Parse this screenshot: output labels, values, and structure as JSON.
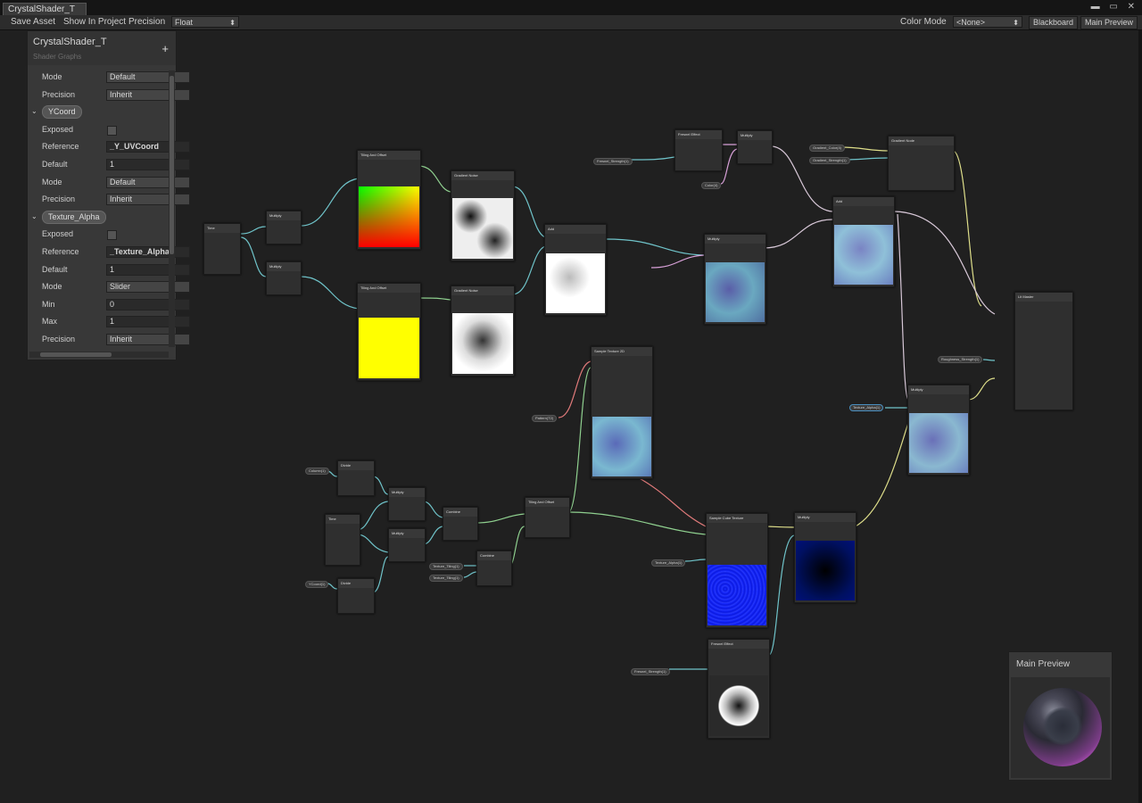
{
  "window": {
    "tab_title": "CrystalShader_T",
    "controls": "▬ ▭ ✕"
  },
  "toolbar": {
    "save_asset": "Save Asset",
    "show_in_project": "Show In Project",
    "precision_label": "Precision",
    "precision_value": "Float",
    "color_mode_label": "Color Mode",
    "color_mode_value": "<None>",
    "blackboard": "Blackboard",
    "main_preview": "Main Preview"
  },
  "blackboard": {
    "title": "CrystalShader_T",
    "subtitle": "Shader Graphs",
    "add_icon": "+",
    "rows": [
      {
        "type": "field",
        "label": "Mode",
        "value": "Default"
      },
      {
        "type": "field",
        "label": "Precision",
        "value": "Inherit"
      },
      {
        "type": "prop",
        "label": "YCoord"
      },
      {
        "type": "check",
        "label": "Exposed"
      },
      {
        "type": "bold",
        "label": "Reference",
        "value": "_Y_UVCoord"
      },
      {
        "type": "num",
        "label": "Default",
        "value": "1"
      },
      {
        "type": "field",
        "label": "Mode",
        "value": "Default"
      },
      {
        "type": "field",
        "label": "Precision",
        "value": "Inherit"
      },
      {
        "type": "prop",
        "label": "Texture_Alpha"
      },
      {
        "type": "check",
        "label": "Exposed"
      },
      {
        "type": "bold",
        "label": "Reference",
        "value": "_Texture_Alpha"
      },
      {
        "type": "num",
        "label": "Default",
        "value": "1"
      },
      {
        "type": "field",
        "label": "Mode",
        "value": "Slider"
      },
      {
        "type": "num",
        "label": "Min",
        "value": "0"
      },
      {
        "type": "num",
        "label": "Max",
        "value": "1"
      },
      {
        "type": "field",
        "label": "Precision",
        "value": "Inherit"
      }
    ]
  },
  "main_preview": {
    "title": "Main Preview"
  },
  "nodes": [
    {
      "title": "Time"
    },
    {
      "title": "Multiply"
    },
    {
      "title": "Multiply"
    },
    {
      "title": "Tiling And Offset"
    },
    {
      "title": "Tiling And Offset"
    },
    {
      "title": "Gradient Noise"
    },
    {
      "title": "Gradient Noise"
    },
    {
      "title": "Add"
    },
    {
      "title": "Fresnel Effect"
    },
    {
      "title": "Multiply"
    },
    {
      "title": "Multiply"
    },
    {
      "title": "Add"
    },
    {
      "title": "Gradient Node"
    },
    {
      "title": "Sample Texture 2D"
    },
    {
      "title": "Lit Master"
    },
    {
      "title": "Multiply"
    },
    {
      "title": "Divide"
    },
    {
      "title": "Time"
    },
    {
      "title": "Multiply"
    },
    {
      "title": "Multiply"
    },
    {
      "title": "Combine"
    },
    {
      "title": "Divide"
    },
    {
      "title": "Combine"
    },
    {
      "title": "Tiling And Offset"
    },
    {
      "title": "Sample Cube Texture"
    },
    {
      "title": "Multiply"
    },
    {
      "title": "Fresnel Effect"
    }
  ],
  "pills": [
    {
      "label": "Fresnel_Strength(1)"
    },
    {
      "label": "Color(4)"
    },
    {
      "label": "Gradient_Color(4)"
    },
    {
      "label": "Gradient_Strength(1)"
    },
    {
      "label": "Pattern(T2)"
    },
    {
      "label": "Roughness_Strength(1)"
    },
    {
      "label": "Texture_Alpha(1)"
    },
    {
      "label": "Column(1)"
    },
    {
      "label": "YCoord(1)"
    },
    {
      "label": "Texture_Tiling(1)"
    },
    {
      "label": "Texture_Tiling(1)"
    },
    {
      "label": "Texture_Alpha(1)"
    },
    {
      "label": "Fresnel_Strength(1)"
    }
  ]
}
